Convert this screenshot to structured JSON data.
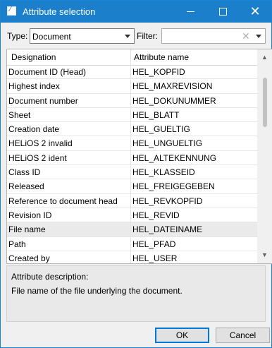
{
  "window": {
    "title": "Attribute selection",
    "icons": {
      "app": "document-attribute-icon",
      "minimize": "minimize-icon",
      "maximize": "maximize-icon",
      "close": "close-icon"
    }
  },
  "toolbar": {
    "type_label": "Type:",
    "type_value": "Document",
    "filter_label": "Filter:",
    "filter_value": ""
  },
  "table": {
    "columns": [
      "Designation",
      "Attribute name"
    ],
    "rows": [
      {
        "designation": "Document ID (Head)",
        "attribute": "HEL_KOPFID"
      },
      {
        "designation": "Highest index",
        "attribute": "HEL_MAXREVISION"
      },
      {
        "designation": "Document number",
        "attribute": "HEL_DOKUNUMMER"
      },
      {
        "designation": "Sheet",
        "attribute": "HEL_BLATT"
      },
      {
        "designation": "Creation date",
        "attribute": "HEL_GUELTIG"
      },
      {
        "designation": "HELiOS 2 invalid",
        "attribute": "HEL_UNGUELTIG"
      },
      {
        "designation": "HELiOS 2 ident",
        "attribute": "HEL_ALTEKENNUNG"
      },
      {
        "designation": "Class ID",
        "attribute": "HEL_KLASSEID"
      },
      {
        "designation": "Released",
        "attribute": "HEL_FREIGEGEBEN"
      },
      {
        "designation": "Reference to document head",
        "attribute": "HEL_REVKOPFID"
      },
      {
        "designation": "Revision ID",
        "attribute": "HEL_REVID"
      },
      {
        "designation": "File name",
        "attribute": "HEL_DATEINAME"
      },
      {
        "designation": "Path",
        "attribute": "HEL_PFAD"
      },
      {
        "designation": "Created by",
        "attribute": "HEL_USER"
      }
    ],
    "selected_index": 11
  },
  "description": {
    "title": "Attribute description:",
    "text": "File name of the file underlying the document."
  },
  "buttons": {
    "ok": "OK",
    "cancel": "Cancel"
  }
}
